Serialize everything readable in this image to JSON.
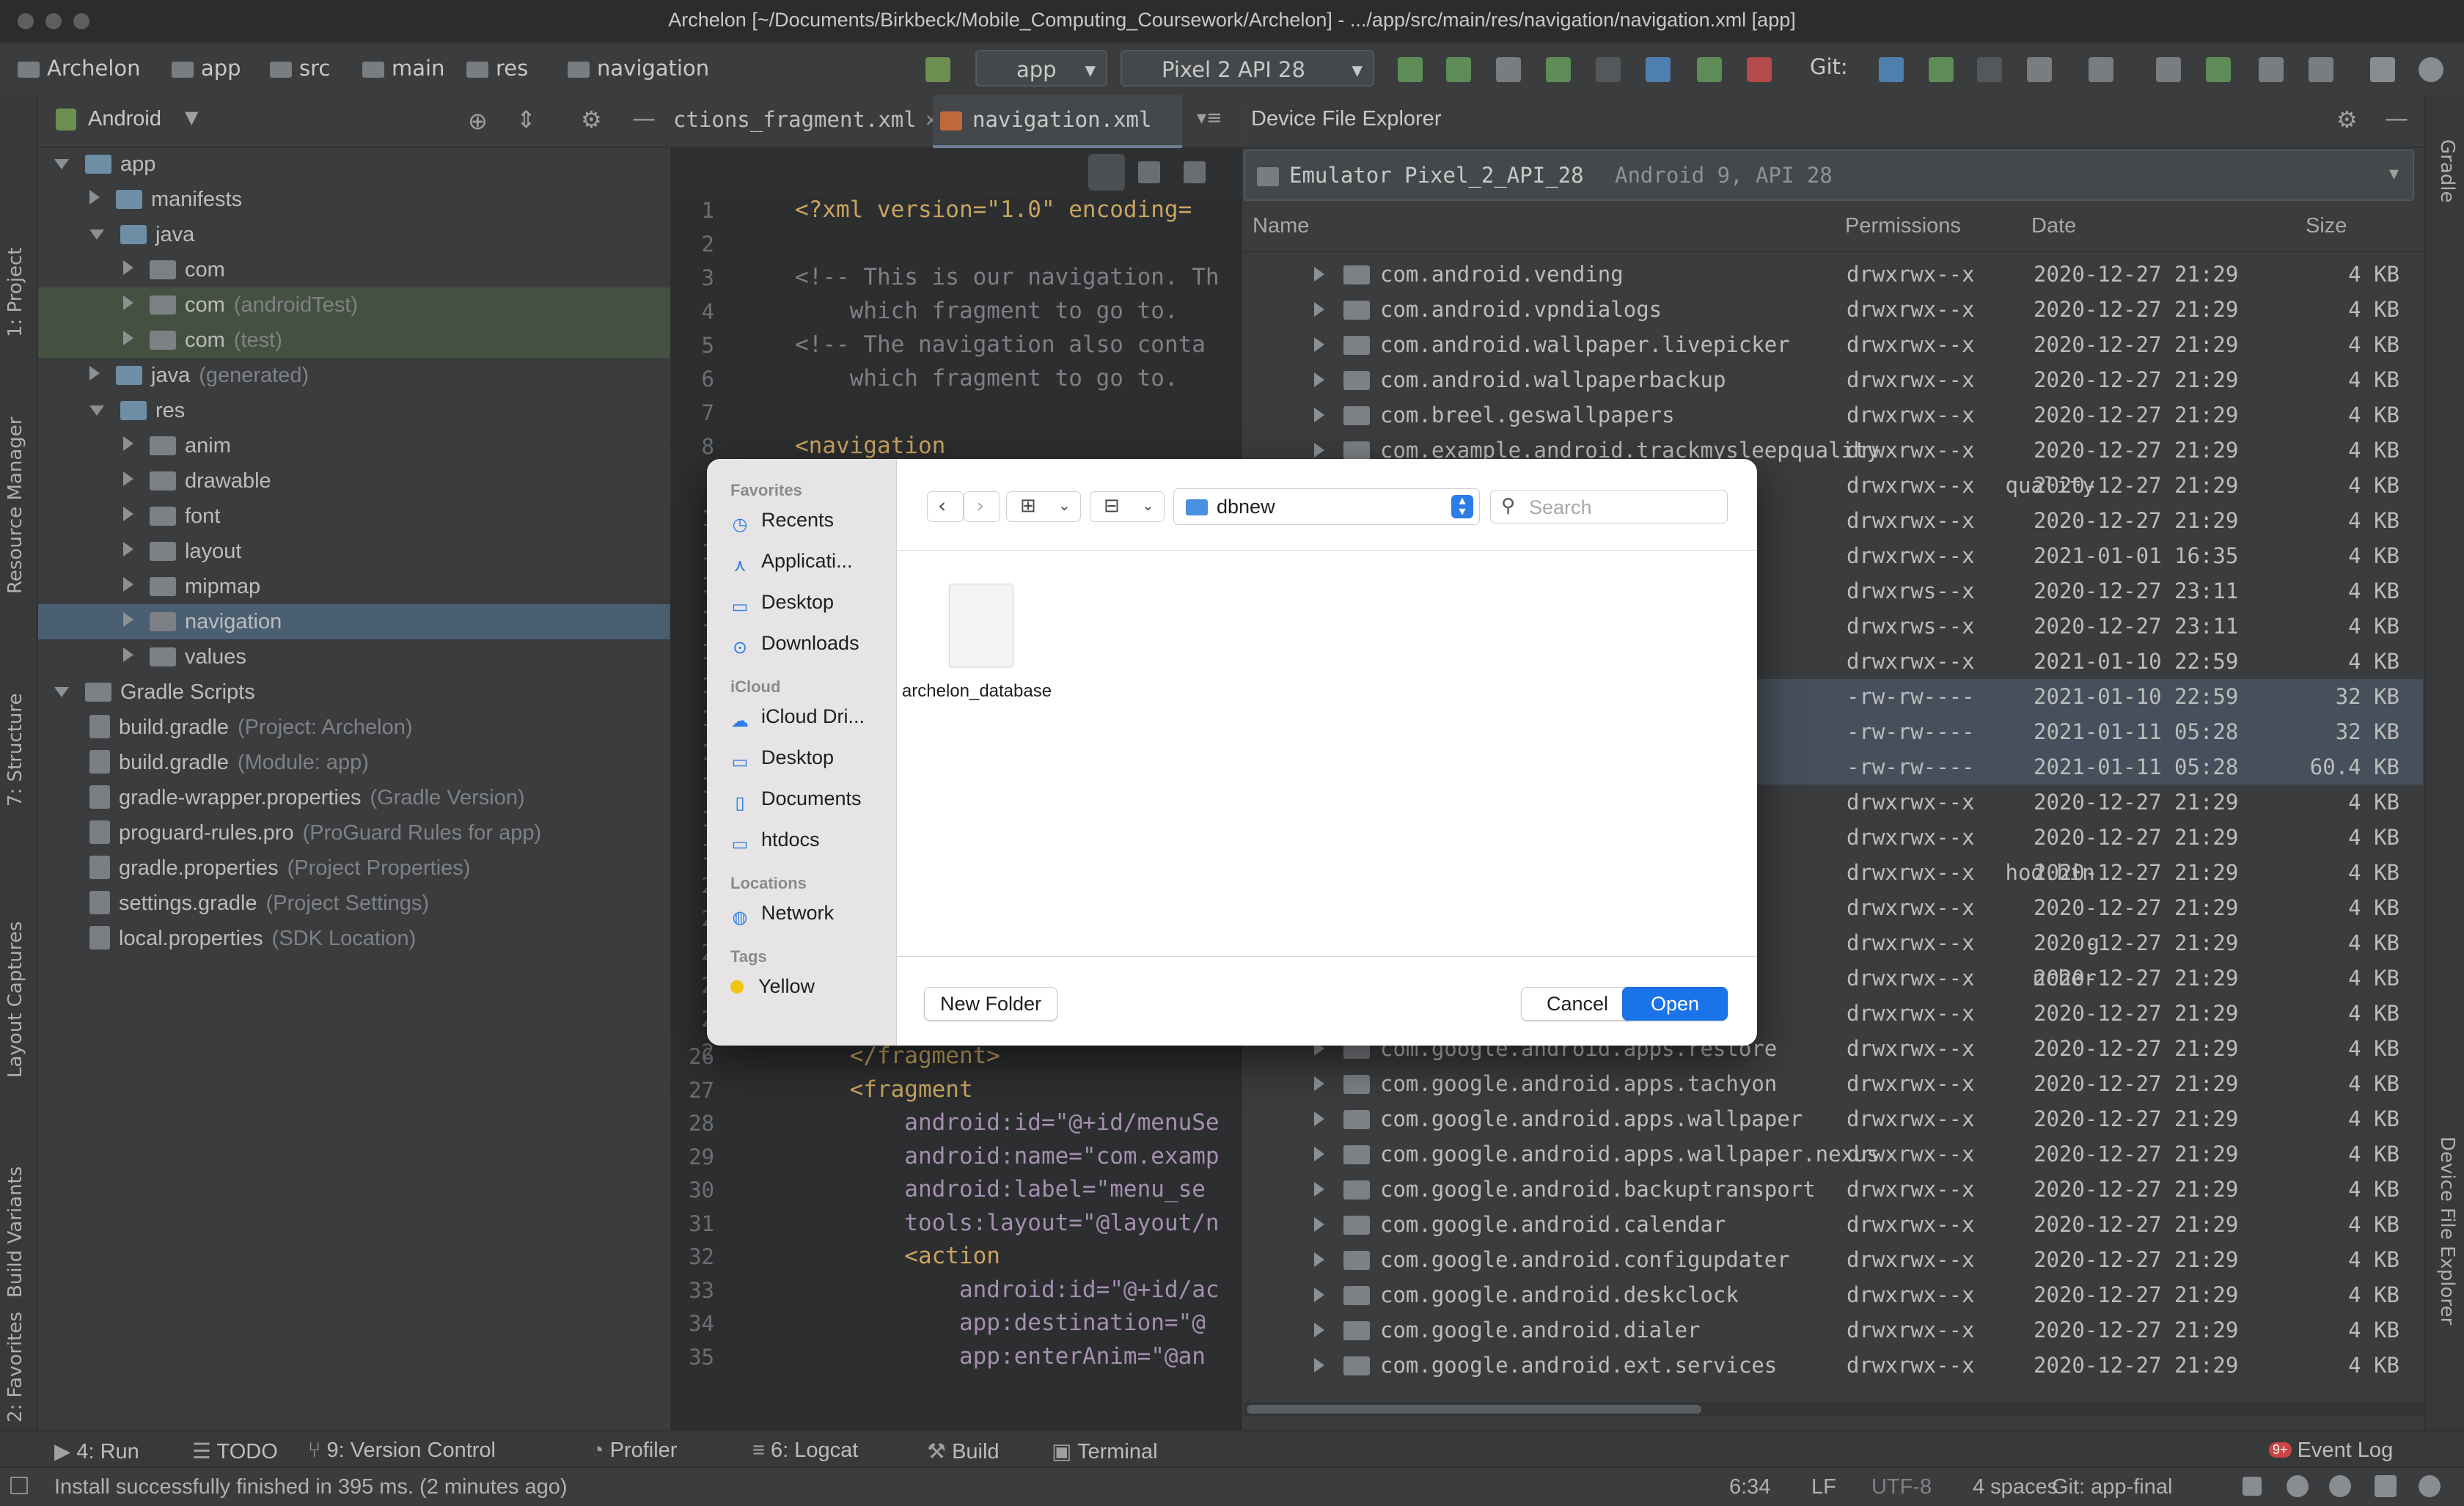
{
  "window": {
    "title": "Archelon [~/Documents/Birkbeck/Mobile_Computing_Coursework/Archelon] - .../app/src/main/res/navigation/navigation.xml [app]"
  },
  "breadcrumb": [
    "Archelon",
    "app",
    "src",
    "main",
    "res",
    "navigation"
  ],
  "toolbar": {
    "run_config": "app",
    "device": "Pixel 2 API 28",
    "git_label": "Git:"
  },
  "left_gutter": {
    "project": "1: Project",
    "resource_manager": "Resource Manager",
    "structure": "7: Structure",
    "layout_captures": "Layout Captures",
    "build_variants": "Build Variants",
    "favorites": "2: Favorites"
  },
  "right_gutter": {
    "gradle": "Gradle",
    "device_file_explorer": "Device File Explorer"
  },
  "project_panel": {
    "view_selector": "Android",
    "tree": [
      {
        "label": "app",
        "suffix": "",
        "depth": 0,
        "arrow": "d",
        "type": "module"
      },
      {
        "label": "manifests",
        "suffix": "",
        "depth": 1,
        "arrow": "r",
        "type": "folder"
      },
      {
        "label": "java",
        "suffix": "",
        "depth": 1,
        "arrow": "d",
        "type": "folder"
      },
      {
        "label": "com",
        "suffix": "",
        "depth": 2,
        "arrow": "r",
        "type": "pkg"
      },
      {
        "label": "com",
        "suffix": "(androidTest)",
        "depth": 2,
        "arrow": "r",
        "type": "pkg"
      },
      {
        "label": "com",
        "suffix": "(test)",
        "depth": 2,
        "arrow": "r",
        "type": "pkg"
      },
      {
        "label": "java",
        "suffix": "(generated)",
        "depth": 1,
        "arrow": "r",
        "type": "folder"
      },
      {
        "label": "res",
        "suffix": "",
        "depth": 1,
        "arrow": "d",
        "type": "folder"
      },
      {
        "label": "anim",
        "suffix": "",
        "depth": 2,
        "arrow": "r",
        "type": "pkg"
      },
      {
        "label": "drawable",
        "suffix": "",
        "depth": 2,
        "arrow": "r",
        "type": "pkg"
      },
      {
        "label": "font",
        "suffix": "",
        "depth": 2,
        "arrow": "r",
        "type": "pkg"
      },
      {
        "label": "layout",
        "suffix": "",
        "depth": 2,
        "arrow": "r",
        "type": "pkg"
      },
      {
        "label": "mipmap",
        "suffix": "",
        "depth": 2,
        "arrow": "r",
        "type": "pkg"
      },
      {
        "label": "navigation",
        "suffix": "",
        "depth": 2,
        "arrow": "r",
        "type": "pkg"
      },
      {
        "label": "values",
        "suffix": "",
        "depth": 2,
        "arrow": "r",
        "type": "pkg"
      },
      {
        "label": "Gradle Scripts",
        "suffix": "",
        "depth": 0,
        "arrow": "d",
        "type": "gradle"
      },
      {
        "label": "build.gradle",
        "suffix": "(Project: Archelon)",
        "depth": 1,
        "arrow": "",
        "type": "file"
      },
      {
        "label": "build.gradle",
        "suffix": "(Module: app)",
        "depth": 1,
        "arrow": "",
        "type": "file"
      },
      {
        "label": "gradle-wrapper.properties",
        "suffix": "(Gradle Version)",
        "depth": 1,
        "arrow": "",
        "type": "file"
      },
      {
        "label": "proguard-rules.pro",
        "suffix": "(ProGuard Rules for app)",
        "depth": 1,
        "arrow": "",
        "type": "file"
      },
      {
        "label": "gradle.properties",
        "suffix": "(Project Properties)",
        "depth": 1,
        "arrow": "",
        "type": "file"
      },
      {
        "label": "settings.gradle",
        "suffix": "(Project Settings)",
        "depth": 1,
        "arrow": "",
        "type": "file"
      },
      {
        "label": "local.properties",
        "suffix": "(SDK Location)",
        "depth": 1,
        "arrow": "",
        "type": "file"
      }
    ]
  },
  "editor": {
    "tabs": [
      "ctions_fragment.xml",
      "navigation.xml"
    ],
    "lines_top": [
      {
        "n": "1",
        "code": "<?xml version=\"1.0\" encoding="
      },
      {
        "n": "2",
        "code": ""
      },
      {
        "n": "3",
        "code": "<!-- This is our navigation. Th"
      },
      {
        "n": "4",
        "code": "    which fragment to go to. "
      },
      {
        "n": "5",
        "code": "<!-- The navigation also conta"
      },
      {
        "n": "6",
        "code": "    which fragment to go to. "
      },
      {
        "n": "7",
        "code": ""
      },
      {
        "n": "8",
        "code": "<navigation"
      }
    ],
    "gutter_partial": [
      "1",
      "1",
      "1",
      "1",
      "1",
      "1",
      "1",
      "1",
      "1",
      "1",
      "1",
      "2",
      "2",
      "2",
      "2",
      "2",
      "2"
    ],
    "lines_bottom": [
      {
        "n": "26",
        "code": "    </fragment>"
      },
      {
        "n": "27",
        "code": "    <fragment"
      },
      {
        "n": "28",
        "code": "        android:id=\"@+id/menuSe"
      },
      {
        "n": "29",
        "code": "        android:name=\"com.examp"
      },
      {
        "n": "30",
        "code": "        android:label=\"menu_se"
      },
      {
        "n": "31",
        "code": "        tools:layout=\"@layout/n"
      },
      {
        "n": "32",
        "code": "        <action"
      },
      {
        "n": "33",
        "code": "            android:id=\"@+id/ac"
      },
      {
        "n": "34",
        "code": "            app:destination=\"@"
      },
      {
        "n": "35",
        "code": "            app:enterAnim=\"@an"
      }
    ]
  },
  "device_explorer": {
    "title": "Device File Explorer",
    "device": "Emulator Pixel_2_API_28",
    "device_info": "Android 9, API 28",
    "columns": [
      "Name",
      "Permissions",
      "Date",
      "Size"
    ],
    "rows": [
      {
        "name": "com.android.vending",
        "perm": "drwxrwx--x",
        "date": "2020-12-27 21:29",
        "size": "4 KB",
        "sel": false,
        "folder": true
      },
      {
        "name": "com.android.vpndialogs",
        "perm": "drwxrwx--x",
        "date": "2020-12-27 21:29",
        "size": "4 KB",
        "sel": false,
        "folder": true
      },
      {
        "name": "com.android.wallpaper.livepicker",
        "perm": "drwxrwx--x",
        "date": "2020-12-27 21:29",
        "size": "4 KB",
        "sel": false,
        "folder": true
      },
      {
        "name": "com.android.wallpaperbackup",
        "perm": "drwxrwx--x",
        "date": "2020-12-27 21:29",
        "size": "4 KB",
        "sel": false,
        "folder": true
      },
      {
        "name": "com.breel.geswallpapers",
        "perm": "drwxrwx--x",
        "date": "2020-12-27 21:29",
        "size": "4 KB",
        "sel": false,
        "folder": true
      },
      {
        "name": "com.example.android.trackmysleepquality",
        "perm": "drwxrwx--x",
        "date": "2020-12-27 21:29",
        "size": "4 KB",
        "sel": false,
        "folder": true
      },
      {
        "name": "quality",
        "perm": "drwxrwx--x",
        "date": "2020-12-27 21:29",
        "size": "4 KB",
        "sel": false,
        "folder": false
      },
      {
        "name": "",
        "perm": "drwxrwx--x",
        "date": "2020-12-27 21:29",
        "size": "4 KB",
        "sel": false,
        "folder": false
      },
      {
        "name": "",
        "perm": "drwxrwx--x",
        "date": "2021-01-01 16:35",
        "size": "4 KB",
        "sel": false,
        "folder": false
      },
      {
        "name": "",
        "perm": "drwxrws--x",
        "date": "2020-12-27 23:11",
        "size": "4 KB",
        "sel": false,
        "folder": false
      },
      {
        "name": "",
        "perm": "drwxrws--x",
        "date": "2020-12-27 23:11",
        "size": "4 KB",
        "sel": false,
        "folder": false
      },
      {
        "name": "",
        "perm": "drwxrwx--x",
        "date": "2021-01-10 22:59",
        "size": "4 KB",
        "sel": false,
        "folder": false
      },
      {
        "name": "",
        "perm": "-rw-rw----",
        "date": "2021-01-10 22:59",
        "size": "32 KB",
        "sel": true,
        "folder": false
      },
      {
        "name": "",
        "perm": "-rw-rw----",
        "date": "2021-01-11 05:28",
        "size": "32 KB",
        "sel": true,
        "folder": false
      },
      {
        "name": "",
        "perm": "-rw-rw----",
        "date": "2021-01-11 05:28",
        "size": "60.4 KB",
        "sel": true,
        "folder": false
      },
      {
        "name": "",
        "perm": "drwxrwx--x",
        "date": "2020-12-27 21:29",
        "size": "4 KB",
        "sel": false,
        "folder": false
      },
      {
        "name": "",
        "perm": "drwxrwx--x",
        "date": "2020-12-27 21:29",
        "size": "4 KB",
        "sel": false,
        "folder": false
      },
      {
        "name": "hod.hin",
        "perm": "drwxrwx--x",
        "date": "2020-12-27 21:29",
        "size": "4 KB",
        "sel": false,
        "folder": false
      },
      {
        "name": "",
        "perm": "drwxrwx--x",
        "date": "2020-12-27 21:29",
        "size": "4 KB",
        "sel": false,
        "folder": false
      },
      {
        "name": "g",
        "perm": "drwxrwx--x",
        "date": "2020-12-27 21:29",
        "size": "4 KB",
        "sel": false,
        "folder": false
      },
      {
        "name": "ncher",
        "perm": "drwxrwx--x",
        "date": "2020-12-27 21:29",
        "size": "4 KB",
        "sel": false,
        "folder": false
      },
      {
        "name": "",
        "perm": "drwxrwx--x",
        "date": "2020-12-27 21:29",
        "size": "4 KB",
        "sel": false,
        "folder": false
      },
      {
        "name": "com.google.android.apps.restore",
        "perm": "drwxrwx--x",
        "date": "2020-12-27 21:29",
        "size": "4 KB",
        "sel": false,
        "folder": true
      },
      {
        "name": "com.google.android.apps.tachyon",
        "perm": "drwxrwx--x",
        "date": "2020-12-27 21:29",
        "size": "4 KB",
        "sel": false,
        "folder": true
      },
      {
        "name": "com.google.android.apps.wallpaper",
        "perm": "drwxrwx--x",
        "date": "2020-12-27 21:29",
        "size": "4 KB",
        "sel": false,
        "folder": true
      },
      {
        "name": "com.google.android.apps.wallpaper.nexus",
        "perm": "drwxrwx--x",
        "date": "2020-12-27 21:29",
        "size": "4 KB",
        "sel": false,
        "folder": true
      },
      {
        "name": "com.google.android.backuptransport",
        "perm": "drwxrwx--x",
        "date": "2020-12-27 21:29",
        "size": "4 KB",
        "sel": false,
        "folder": true
      },
      {
        "name": "com.google.android.calendar",
        "perm": "drwxrwx--x",
        "date": "2020-12-27 21:29",
        "size": "4 KB",
        "sel": false,
        "folder": true
      },
      {
        "name": "com.google.android.configupdater",
        "perm": "drwxrwx--x",
        "date": "2020-12-27 21:29",
        "size": "4 KB",
        "sel": false,
        "folder": true
      },
      {
        "name": "com.google.android.deskclock",
        "perm": "drwxrwx--x",
        "date": "2020-12-27 21:29",
        "size": "4 KB",
        "sel": false,
        "folder": true
      },
      {
        "name": "com.google.android.dialer",
        "perm": "drwxrwx--x",
        "date": "2020-12-27 21:29",
        "size": "4 KB",
        "sel": false,
        "folder": true
      },
      {
        "name": "com.google.android.ext.services",
        "perm": "drwxrwx--x",
        "date": "2020-12-27 21:29",
        "size": "4 KB",
        "sel": false,
        "folder": true
      }
    ]
  },
  "tool_windows": {
    "run": "4: Run",
    "todo": "TODO",
    "version_control": "9: Version Control",
    "profiler": "Profiler",
    "logcat": "6: Logcat",
    "build": "Build",
    "terminal": "Terminal",
    "event_log": "Event Log",
    "event_badge": "9+"
  },
  "status_bar": {
    "message": "Install successfully finished in 395 ms. (2 minutes ago)",
    "position": "6:34",
    "line_sep": "LF",
    "encoding": "UTF-8",
    "indent": "4 spaces",
    "git": "Git: app-final"
  },
  "dialog": {
    "sidebar": {
      "favorites_label": "Favorites",
      "favorites": [
        {
          "label": "Recents",
          "icon": "clock-icon"
        },
        {
          "label": "Applicati...",
          "icon": "applications-icon"
        },
        {
          "label": "Desktop",
          "icon": "desktop-icon"
        },
        {
          "label": "Downloads",
          "icon": "downloads-icon"
        }
      ],
      "icloud_label": "iCloud",
      "icloud": [
        {
          "label": "iCloud Dri...",
          "icon": "cloud-icon"
        },
        {
          "label": "Desktop",
          "icon": "desktop-icon"
        },
        {
          "label": "Documents",
          "icon": "document-icon"
        },
        {
          "label": "htdocs",
          "icon": "folder-icon"
        }
      ],
      "locations_label": "Locations",
      "locations": [
        {
          "label": "Network",
          "icon": "globe-icon"
        }
      ],
      "tags_label": "Tags",
      "tags": [
        {
          "label": "Yellow",
          "color": "#f2c40f"
        }
      ]
    },
    "folder": "dbnew",
    "search_placeholder": "Search",
    "file_label": "archelon_database",
    "new_folder": "New Folder",
    "cancel": "Cancel",
    "open": "Open",
    "accent": "#1a73e8"
  }
}
